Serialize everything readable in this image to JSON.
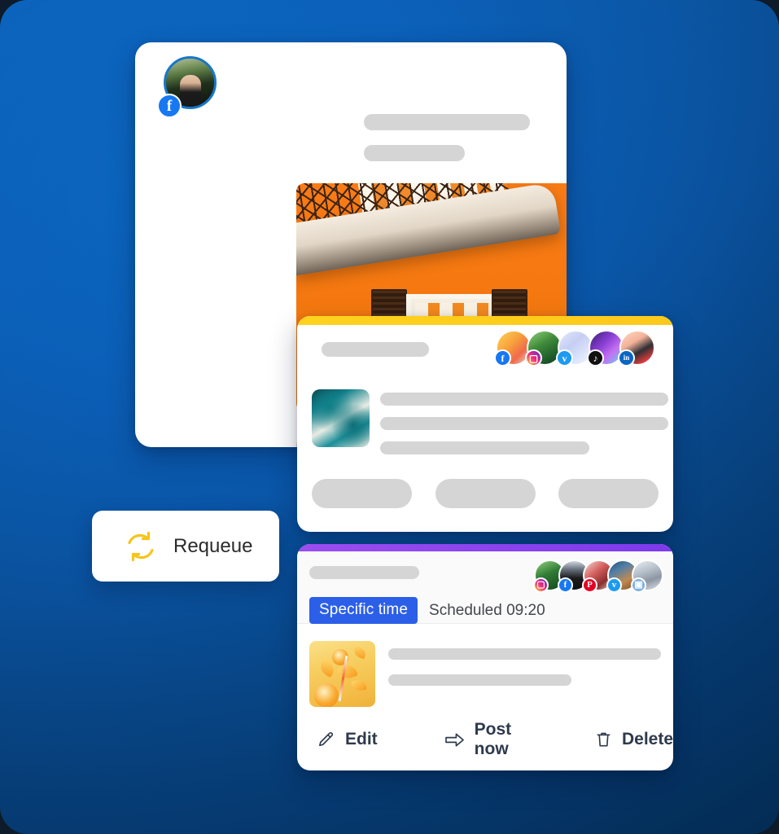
{
  "theme": {
    "background_start": "#0a64bd",
    "background_end": "#05325f",
    "accent_yellow": "#ffd21e",
    "accent_purple": "#8b44ee",
    "badge_blue": "#2c5fe8",
    "card_white": "#ffffff",
    "skeleton_gray": "#d5d5d5"
  },
  "post_card": {
    "name": "social-post-preview",
    "avatar_network": "facebook",
    "avatar_badge_glyph": "f",
    "menu_icon": "more-dot-icon",
    "photo_alt": "orange-building-balcony-photo"
  },
  "compose_card": {
    "name": "compose-post-card",
    "accent_color": "#ffd21e",
    "thumbnail_alt": "teal-marble-thumbnail",
    "accounts": [
      {
        "network": "facebook",
        "glyph": "f",
        "badge_class": "bg-fb",
        "image_class": "img-a"
      },
      {
        "network": "instagram",
        "glyph": "▢",
        "badge_class": "bg-ig",
        "image_class": "img-b"
      },
      {
        "network": "twitter",
        "glyph": "ᴠ",
        "badge_class": "bg-tw",
        "image_class": "img-c"
      },
      {
        "network": "tiktok",
        "glyph": "♪",
        "badge_class": "bg-tt",
        "image_class": "img-d"
      },
      {
        "network": "linkedin",
        "glyph": "in",
        "badge_class": "bg-li",
        "image_class": "img-e"
      }
    ],
    "button_count": 3
  },
  "scheduled_card": {
    "name": "scheduled-post-card",
    "accent_color": "#8b44ee",
    "time_type_label": "Specific time",
    "status_text": "Scheduled 09:20",
    "thumbnail_alt": "orange-citrus-splash-thumbnail",
    "accounts": [
      {
        "network": "instagram",
        "glyph": "▢",
        "badge_class": "bg-ig",
        "image_class": "img-f"
      },
      {
        "network": "facebook",
        "glyph": "f",
        "badge_class": "bg-fb",
        "image_class": "img-g"
      },
      {
        "network": "pinterest",
        "glyph": "P",
        "badge_class": "bg-pin",
        "image_class": "img-h"
      },
      {
        "network": "twitter",
        "glyph": "ᴠ",
        "badge_class": "bg-tw",
        "image_class": "img-i"
      },
      {
        "network": "tumblr",
        "glyph": "▣",
        "badge_class": "bg-tumblr",
        "image_class": "img-j"
      }
    ],
    "actions": [
      {
        "label": "Edit",
        "icon": "pencil-icon"
      },
      {
        "label": "Post now",
        "icon": "arrow-right-icon"
      },
      {
        "label": "Delete",
        "icon": "trash-icon"
      }
    ]
  },
  "requeue_button": {
    "name": "requeue-button",
    "label": "Requeue",
    "icon": "refresh-cycle-icon",
    "icon_color": "#f5c518"
  }
}
